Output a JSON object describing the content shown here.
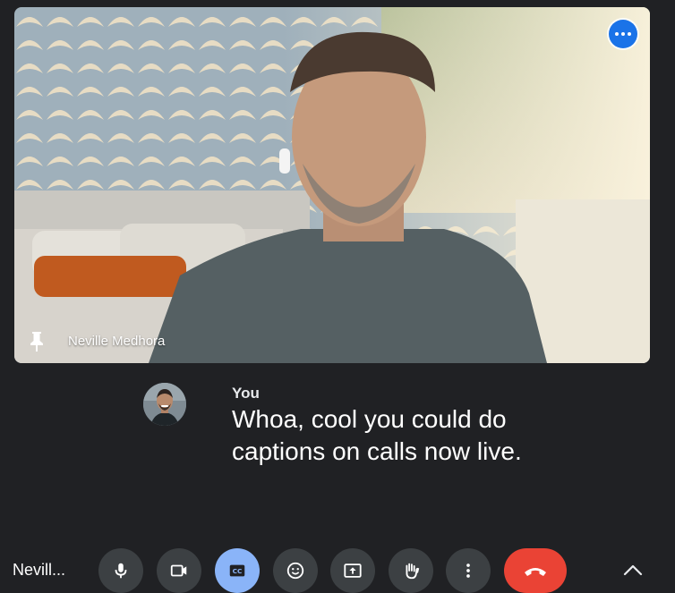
{
  "participant": {
    "name": "Neville Medhora"
  },
  "captions": {
    "speaker": "You",
    "text": "Whoa, cool you could do captions on calls now live."
  },
  "bottom_bar": {
    "self_name": "Nevill...",
    "controls": [
      "microphone-icon",
      "camera-icon",
      "closed-captions-icon",
      "emoji-icon",
      "present-screen-icon",
      "raise-hand-icon",
      "more-options-icon",
      "end-call-icon",
      "expand-icon"
    ]
  },
  "colors": {
    "background": "#202124",
    "control_button": "#3c4043",
    "captions_active": "#8ab4f8",
    "end_call": "#ea4335",
    "tile_menu": "#1a73e8"
  }
}
